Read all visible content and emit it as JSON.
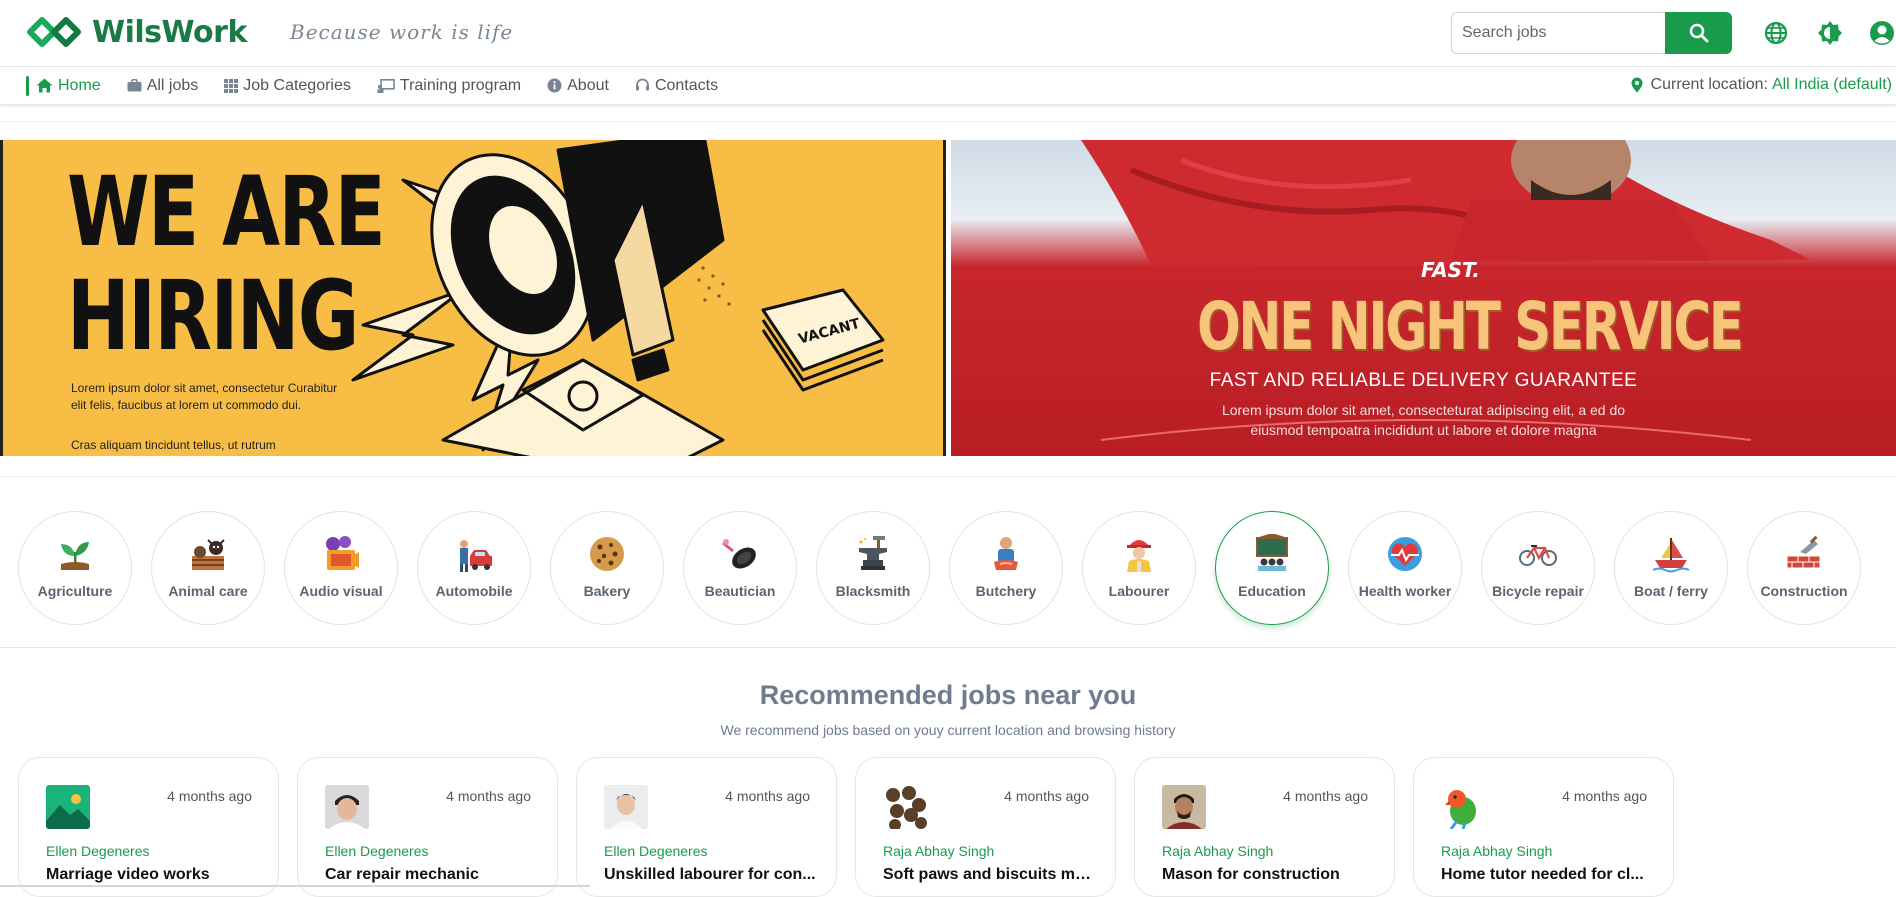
{
  "header": {
    "brand": "WilsWork",
    "tagline": "Because work is life",
    "search_placeholder": "Search jobs"
  },
  "nav": {
    "items": [
      {
        "label": "Home",
        "icon": "home-icon"
      },
      {
        "label": "All jobs",
        "icon": "briefcase-icon"
      },
      {
        "label": "Job Categories",
        "icon": "grid-icon"
      },
      {
        "label": "Training program",
        "icon": "chalkboard-icon"
      },
      {
        "label": "About",
        "icon": "info-icon"
      },
      {
        "label": "Contacts",
        "icon": "headset-icon"
      }
    ],
    "location_label": "Current location:",
    "location_value": "All India (default)"
  },
  "banners": {
    "left": {
      "title_line1": "WE ARE",
      "title_line2": "HIRING",
      "desc": "Lorem ipsum dolor sit amet, consectetur Curabitur elit felis, faucibus at lorem ut commodo dui.",
      "desc2": "Cras aliquam tincidunt tellus, ut rutrum",
      "sign_text": "VACANT"
    },
    "right": {
      "brand": "FAST.",
      "title": "ONE NIGHT SERVICE",
      "subtitle": "FAST AND RELIABLE DELIVERY GUARANTEE",
      "desc": "Lorem ipsum dolor sit amet, consecteturat adipiscing elit, a ed do eiusmod tempoatra incididunt ut labore et dolore magna"
    }
  },
  "categories": [
    {
      "label": "Agriculture",
      "icon": "plant-icon"
    },
    {
      "label": "Animal care",
      "icon": "cow-icon"
    },
    {
      "label": "Audio visual",
      "icon": "film-icon"
    },
    {
      "label": "Automobile",
      "icon": "car-mechanic-icon"
    },
    {
      "label": "Bakery",
      "icon": "cookie-icon"
    },
    {
      "label": "Beautician",
      "icon": "makeup-icon"
    },
    {
      "label": "Blacksmith",
      "icon": "anvil-icon"
    },
    {
      "label": "Butchery",
      "icon": "butcher-icon"
    },
    {
      "label": "Labourer",
      "icon": "worker-icon"
    },
    {
      "label": "Education",
      "icon": "classroom-icon"
    },
    {
      "label": "Health worker",
      "icon": "heart-health-icon"
    },
    {
      "label": "Bicycle repair",
      "icon": "bicycle-icon"
    },
    {
      "label": "Boat / ferry",
      "icon": "boat-icon"
    },
    {
      "label": "Construction",
      "icon": "brick-trowel-icon"
    }
  ],
  "recommended": {
    "title": "Recommended jobs near you",
    "subtitle": "We recommend jobs based on youy current location and browsing history",
    "jobs": [
      {
        "time": "4 months ago",
        "poster": "Ellen Degeneres",
        "title": "Marriage video works",
        "thumb": "image-placeholder-icon"
      },
      {
        "time": "4 months ago",
        "poster": "Ellen Degeneres",
        "title": "Car repair mechanic",
        "thumb": "person-photo"
      },
      {
        "time": "4 months ago",
        "poster": "Ellen Degeneres",
        "title": "Unskilled labourer for con...",
        "thumb": "person-photo"
      },
      {
        "time": "4 months ago",
        "poster": "Raja Abhay Singh",
        "title": "Soft paws and biscuits ma...",
        "thumb": "biscuits-photo"
      },
      {
        "time": "4 months ago",
        "poster": "Raja Abhay Singh",
        "title": "Mason for construction",
        "thumb": "person-photo"
      },
      {
        "time": "4 months ago",
        "poster": "Raja Abhay Singh",
        "title": "Home tutor needed for cl...",
        "thumb": "parrot-photo"
      }
    ]
  },
  "colors": {
    "brand_green": "#1a9b4b",
    "banner_yellow": "#f7bd45",
    "banner_red": "#c8262c",
    "muted_blue_gray": "#6f7b90"
  }
}
